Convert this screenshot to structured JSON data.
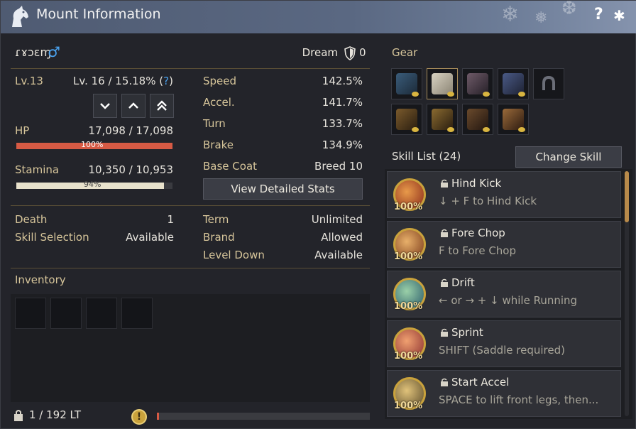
{
  "window": {
    "title": "Mount Information",
    "help_label": "?"
  },
  "mount": {
    "name": "ɾɤɔɛɱ",
    "gender_symbol": "♂",
    "grade_label": "Dream",
    "grade_value": "0"
  },
  "level": {
    "label": "Lv.13",
    "progress_text": "Lv. 16 / 15.18% (",
    "help_mark": "?",
    "close_paren": ")"
  },
  "hp": {
    "label": "HP",
    "value": "17,098 / 17,098",
    "percent_text": "100%",
    "fill_fraction": 1.0,
    "color": "#d65a44"
  },
  "stamina": {
    "label": "Stamina",
    "value": "10,350 / 10,953",
    "percent_text": "94%",
    "fill_fraction": 0.945,
    "color": "#e8e2cc"
  },
  "stats": [
    {
      "label": "Speed",
      "value": "142.5%"
    },
    {
      "label": "Accel.",
      "value": "141.7%"
    },
    {
      "label": "Turn",
      "value": "133.7%"
    },
    {
      "label": "Brake",
      "value": "134.9%"
    },
    {
      "label": "Base Coat",
      "value": "Breed 10"
    }
  ],
  "view_detailed_stats_label": "View Detailed Stats",
  "info_left": [
    {
      "label": "Death",
      "value": "1"
    },
    {
      "label": "Skill Selection",
      "value": "Available"
    }
  ],
  "info_right": [
    {
      "label": "Term",
      "value": "Unlimited"
    },
    {
      "label": "Brand",
      "value": "Allowed"
    },
    {
      "label": "Level Down",
      "value": "Available"
    }
  ],
  "inventory": {
    "label": "Inventory",
    "weight_text": "1 / 192 LT"
  },
  "gear": {
    "label": "Gear"
  },
  "skills": {
    "header": "Skill List (24)",
    "change_label": "Change Skill",
    "items": [
      {
        "name": "Hind Kick",
        "desc": "↓ + F to Hind Kick",
        "pct": "100%"
      },
      {
        "name": "Fore Chop",
        "desc": "F to Fore Chop",
        "pct": "100%"
      },
      {
        "name": "Drift",
        "desc": "← or → + ↓ while Running",
        "pct": "100%"
      },
      {
        "name": "Sprint",
        "desc": "SHIFT (Saddle required)",
        "pct": "100%"
      },
      {
        "name": "Start Accel",
        "desc": "SPACE to lift front legs, then...",
        "pct": "100%"
      }
    ]
  },
  "colors": {
    "accent_gold": "#d6c59a",
    "title_bar": "#5a6882",
    "hp_bar": "#d65a44"
  }
}
